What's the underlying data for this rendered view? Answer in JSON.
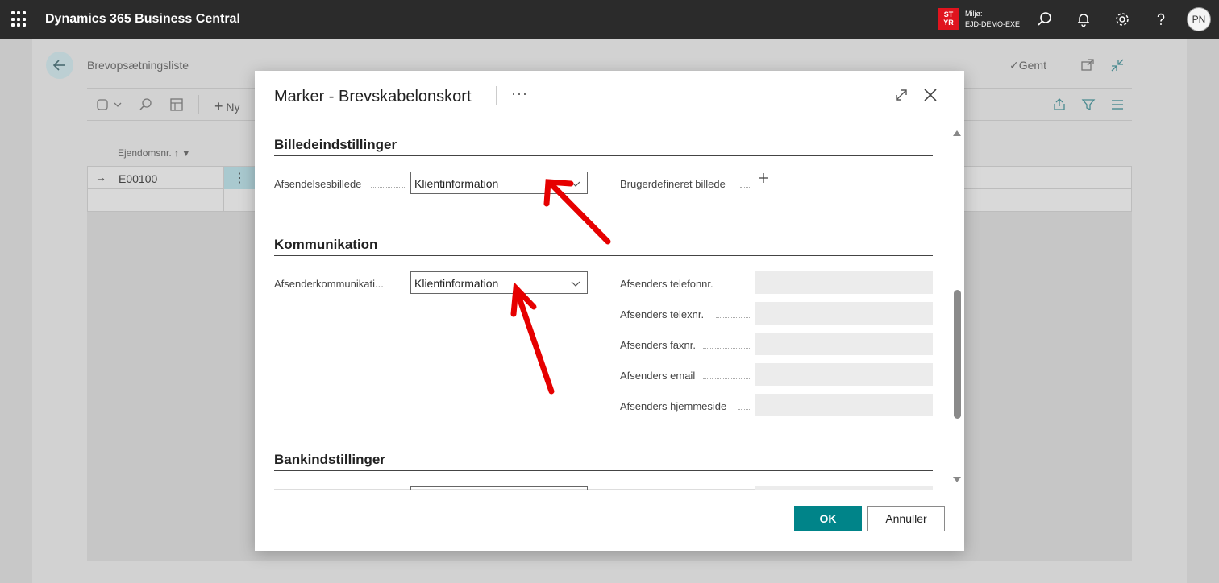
{
  "topbar": {
    "app_title": "Dynamics 365 Business Central",
    "env_badge": "ST YR",
    "env_label": "Miljø:",
    "env_name": "EJD-DEMO-EXE",
    "avatar_initials": "PN"
  },
  "background_page": {
    "title": "Brevopsætningsliste",
    "saved_label": "Gemt",
    "new_label": "Ny",
    "column_header": "Ejendomsnr.",
    "row_value": "E00100"
  },
  "modal": {
    "title": "Marker - Brevskabelonskort",
    "more": "···",
    "sections": {
      "image": {
        "title": "Billedeindstillinger",
        "sender_image_label": "Afsendelsesbillede",
        "sender_image_value": "Klientinformation",
        "custom_image_label": "Brugerdefineret billede"
      },
      "communication": {
        "title": "Kommunikation",
        "sender_comm_label": "Afsenderkommunikati...",
        "sender_comm_value": "Klientinformation",
        "phone_label": "Afsenders telefonnr.",
        "telex_label": "Afsenders telexnr.",
        "fax_label": "Afsenders faxnr.",
        "email_label": "Afsenders email",
        "homepage_label": "Afsenders hjemmeside"
      },
      "bank": {
        "title": "Bankindstillinger"
      }
    },
    "ok_label": "OK",
    "cancel_label": "Annuller"
  },
  "colors": {
    "topbar": "#2b2b2b",
    "accent": "#008489",
    "env_badge": "#e0141e",
    "annotation_arrow": "#e60000"
  }
}
